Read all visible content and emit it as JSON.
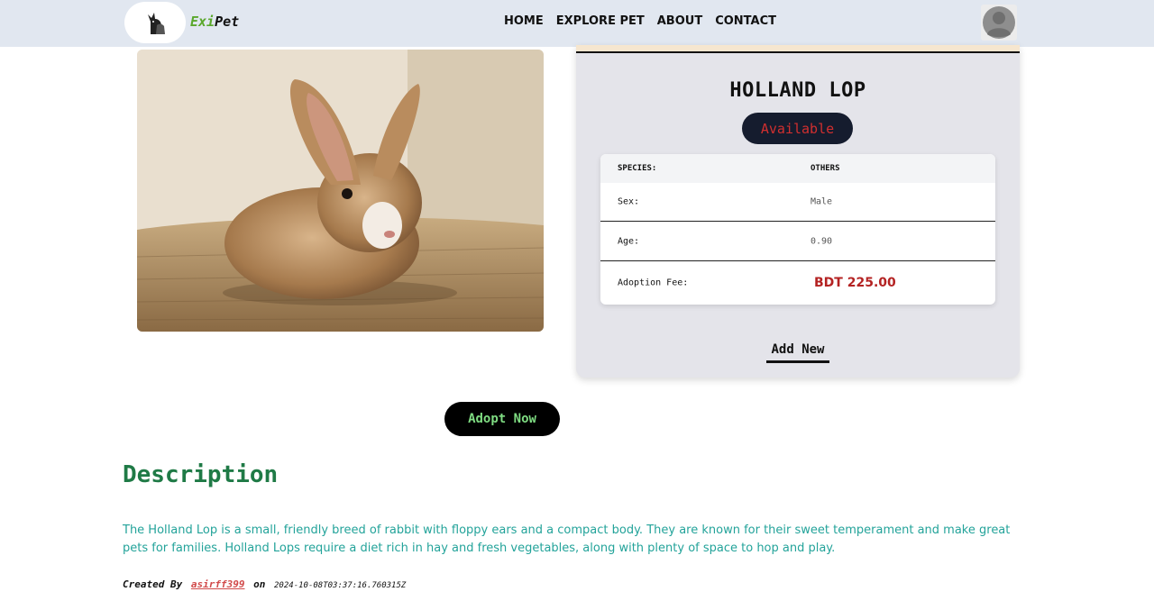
{
  "navbar": {
    "brand_part1": "Exi",
    "brand_part2": "Pet",
    "links": [
      "HOME",
      "EXPLORE PET",
      "ABOUT",
      "CONTACT"
    ]
  },
  "pet": {
    "name": "HOLLAND LOP",
    "status": "Available",
    "details": {
      "header_label": "SPECIES:",
      "header_value": "OTHERS",
      "sex_label": "Sex:",
      "sex_value": "Male",
      "age_label": "Age:",
      "age_value": "0.90",
      "fee_label": "Adoption Fee:",
      "fee_value": "BDT 225.00"
    },
    "add_new_label": "Add New",
    "adopt_label": "Adopt Now"
  },
  "description": {
    "title": "Description",
    "text": "The Holland Lop is a small, friendly breed of rabbit with floppy ears and a compact body. They are known for their sweet temperament and make great pets for families. Holland Lops require a diet rich in hay and fresh vegetables, along with plenty of space to hop and play.",
    "created_by_label": "Created By",
    "author": "asirff399",
    "on_label": "on",
    "timestamp": "2024-10-08T03:37:16.760315Z"
  },
  "colors": {
    "navbar_bg": "#e1e7f0",
    "brand_green": "#5ba82d",
    "status_text": "#d12f2f",
    "fee_text": "#b42323",
    "adopt_text": "#7fdc82",
    "description_title": "#1f7a46",
    "description_text": "#23a39a",
    "author_link": "#d14a4a"
  }
}
